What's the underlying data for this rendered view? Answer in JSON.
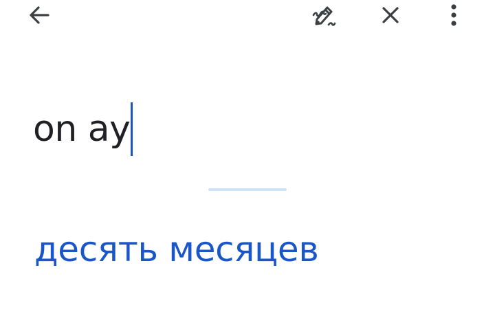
{
  "toolbar": {
    "back_icon": "arrow-left-icon",
    "handwriting_icon": "handwriting-pen-icon",
    "close_icon": "close-icon",
    "more_icon": "more-vertical-icon"
  },
  "input": {
    "source_text": "on ay"
  },
  "result": {
    "translation": "десять месяцев"
  },
  "colors": {
    "icon": "#3c4043",
    "text": "#202124",
    "caret": "#1a56b8",
    "translation": "#1a56c8",
    "divider": "#cfe3f7"
  }
}
